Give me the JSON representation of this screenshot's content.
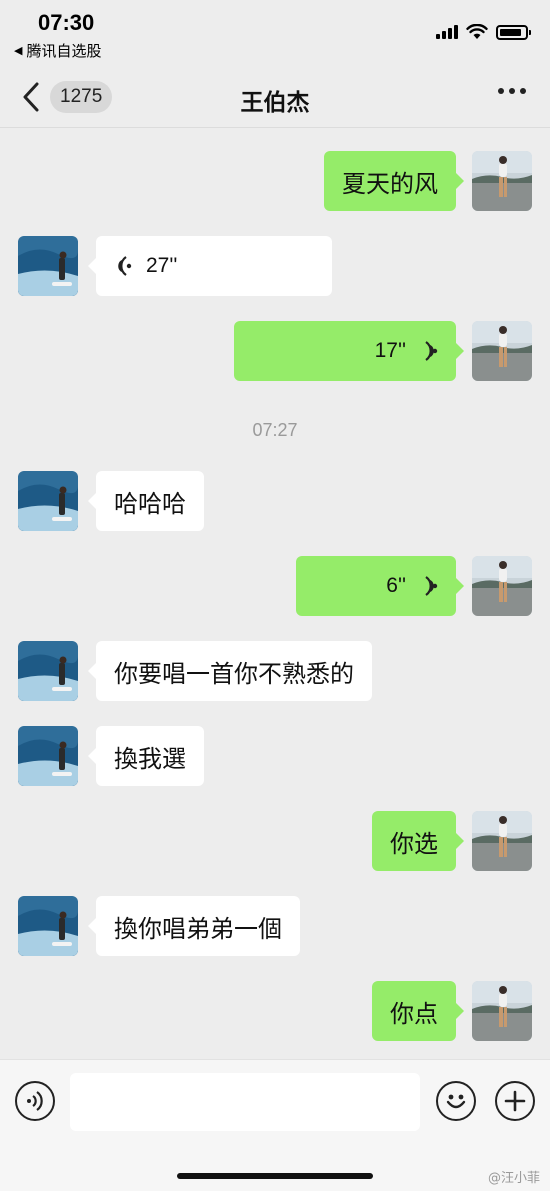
{
  "status_bar": {
    "time": "07:30",
    "back_app": "腾讯自选股",
    "back_arrow": "◀",
    "icons": [
      "signal-icon",
      "wifi-icon",
      "battery-icon"
    ]
  },
  "nav": {
    "back_icon": "chevron-left-icon",
    "unread_count": "1275",
    "title": "王伯杰",
    "more_icon": "more-dots-icon"
  },
  "colors": {
    "sent_bubble": "#95ec69",
    "received_bubble": "#ffffff",
    "background": "#ededed"
  },
  "messages": [
    {
      "side": "right",
      "type": "text",
      "text": "夏天的风"
    },
    {
      "side": "left",
      "type": "voice",
      "duration": "27''"
    },
    {
      "side": "right",
      "type": "voice",
      "duration": "17''"
    },
    {
      "type": "timestamp",
      "text": "07:27"
    },
    {
      "side": "left",
      "type": "text",
      "text": "哈哈哈"
    },
    {
      "side": "right",
      "type": "voice",
      "duration": "6''"
    },
    {
      "side": "left",
      "type": "text",
      "text": "你要唱一首你不熟悉的"
    },
    {
      "side": "left",
      "type": "text",
      "text": "換我選"
    },
    {
      "side": "right",
      "type": "text",
      "text": "你选"
    },
    {
      "side": "left",
      "type": "text",
      "text": "換你唱弟弟一個"
    },
    {
      "side": "right",
      "type": "text",
      "text": "你点"
    }
  ],
  "input_bar": {
    "voice_icon": "voice-mode-icon",
    "emoji_icon": "emoji-icon",
    "plus_icon": "plus-icon",
    "text_value": ""
  },
  "watermark": "@汪小菲"
}
